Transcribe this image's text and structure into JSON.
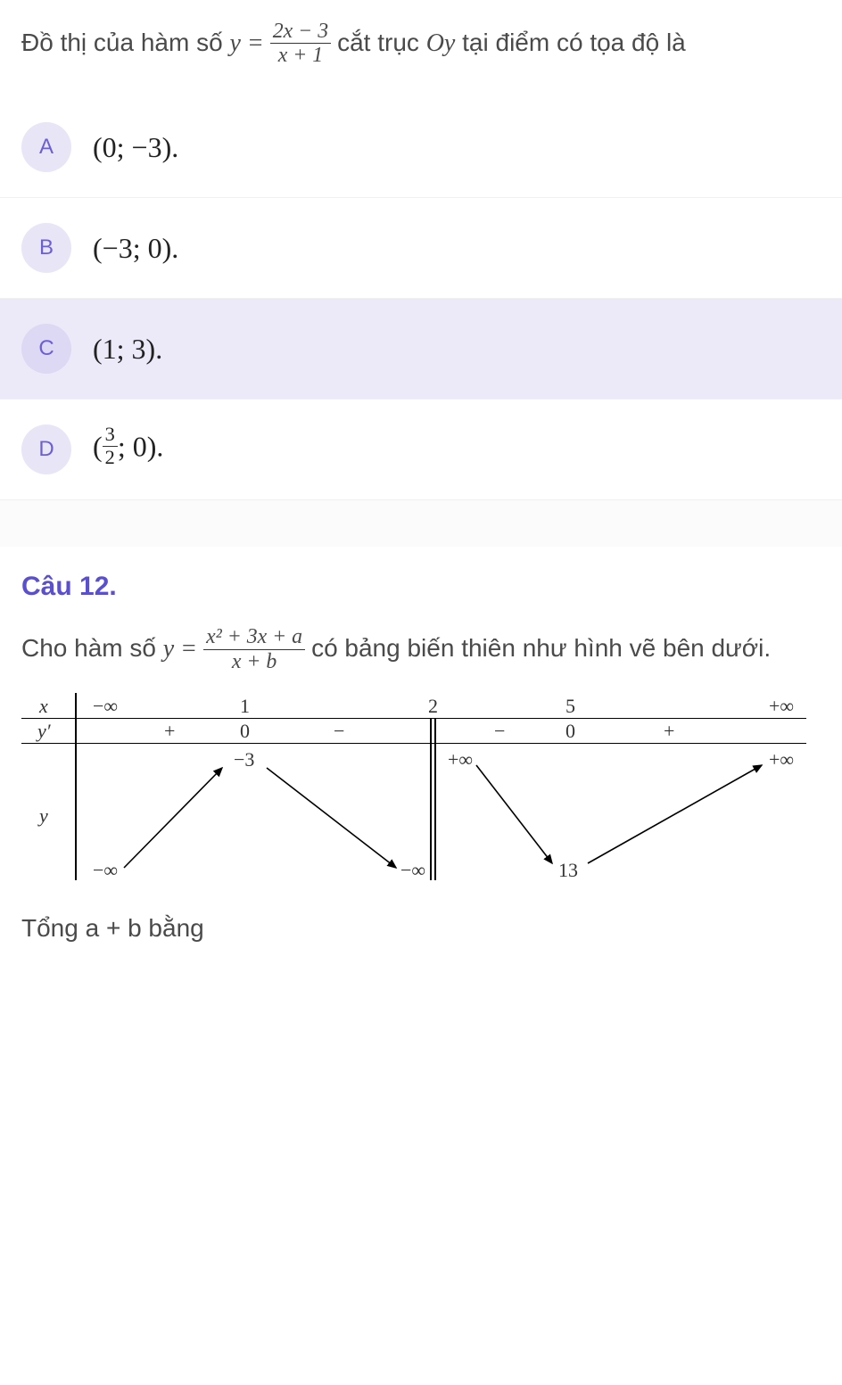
{
  "q1": {
    "text_before": "Đồ thị của hàm số ",
    "y_eq": "y =",
    "frac_num": "2x − 3",
    "frac_den": "x + 1",
    "text_mid": " cắt trục ",
    "Oy": "Oy",
    "text_after": " tại điểm có tọa độ là",
    "options": {
      "A": {
        "letter": "A",
        "content": "(0; −3)."
      },
      "B": {
        "letter": "B",
        "content": "(−3; 0)."
      },
      "C": {
        "letter": "C",
        "content": "(1; 3)."
      },
      "D": {
        "letter": "D",
        "content_open": "(",
        "frac_num": "3",
        "frac_den": "2",
        "content_close": "; 0)."
      }
    }
  },
  "q2": {
    "title": "Câu 12.",
    "text_before": "Cho hàm số ",
    "y_eq": "y =",
    "frac_num": "x² + 3x + a",
    "frac_den": "x + b",
    "text_mid": " có bảng biến thiên như hình vẽ bên dưới.",
    "final": "Tổng a + b bằng"
  },
  "chart_data": {
    "type": "table",
    "description": "Variation table (bảng biến thiên)",
    "rows": {
      "x": [
        "−∞",
        "1",
        "2",
        "5",
        "+∞"
      ],
      "y_prime": [
        "+",
        "0",
        "−",
        "||",
        "−",
        "0",
        "+"
      ],
      "y": {
        "segments": [
          {
            "from": "−∞",
            "to": "−3",
            "direction": "up",
            "x_from": "−∞",
            "x_to": "1"
          },
          {
            "from": "−3",
            "to": "−∞",
            "direction": "down",
            "x_from": "1",
            "x_to": "2"
          },
          {
            "from": "+∞",
            "to": "13",
            "direction": "down",
            "x_from": "2",
            "x_to": "5"
          },
          {
            "from": "13",
            "to": "+∞",
            "direction": "up",
            "x_from": "5",
            "x_to": "+∞"
          }
        ],
        "local_max": {
          "x": "1",
          "y": "−3"
        },
        "local_min": {
          "x": "5",
          "y": "13"
        },
        "vertical_asymptote": "2"
      }
    },
    "labels": {
      "x": "x",
      "yprime": "y′",
      "y": "y",
      "neg_inf": "−∞",
      "pos_inf": "+∞",
      "one": "1",
      "two": "2",
      "five": "5",
      "plus": "+",
      "minus": "−",
      "zero": "0",
      "neg3": "−3",
      "thirteen": "13"
    }
  }
}
